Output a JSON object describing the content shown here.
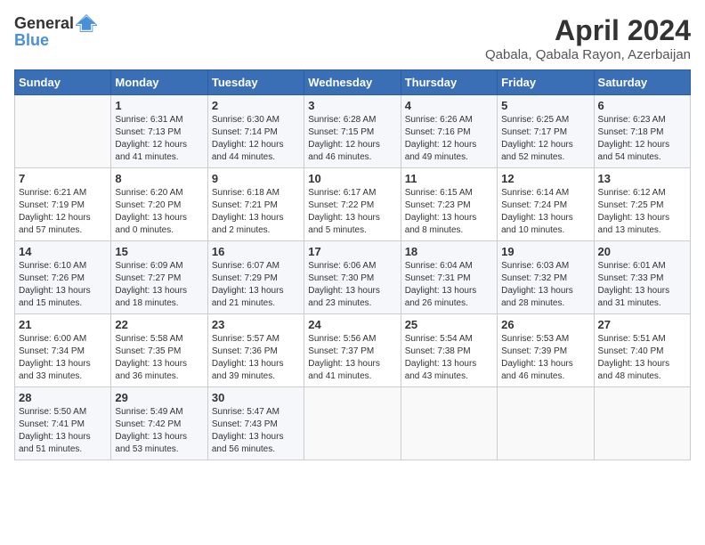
{
  "header": {
    "logo_general": "General",
    "logo_blue": "Blue",
    "month_title": "April 2024",
    "location": "Qabala, Qabala Rayon, Azerbaijan"
  },
  "calendar": {
    "days_of_week": [
      "Sunday",
      "Monday",
      "Tuesday",
      "Wednesday",
      "Thursday",
      "Friday",
      "Saturday"
    ],
    "weeks": [
      [
        {
          "day": "",
          "sunrise": "",
          "sunset": "",
          "daylight": ""
        },
        {
          "day": "1",
          "sunrise": "Sunrise: 6:31 AM",
          "sunset": "Sunset: 7:13 PM",
          "daylight": "Daylight: 12 hours and 41 minutes."
        },
        {
          "day": "2",
          "sunrise": "Sunrise: 6:30 AM",
          "sunset": "Sunset: 7:14 PM",
          "daylight": "Daylight: 12 hours and 44 minutes."
        },
        {
          "day": "3",
          "sunrise": "Sunrise: 6:28 AM",
          "sunset": "Sunset: 7:15 PM",
          "daylight": "Daylight: 12 hours and 46 minutes."
        },
        {
          "day": "4",
          "sunrise": "Sunrise: 6:26 AM",
          "sunset": "Sunset: 7:16 PM",
          "daylight": "Daylight: 12 hours and 49 minutes."
        },
        {
          "day": "5",
          "sunrise": "Sunrise: 6:25 AM",
          "sunset": "Sunset: 7:17 PM",
          "daylight": "Daylight: 12 hours and 52 minutes."
        },
        {
          "day": "6",
          "sunrise": "Sunrise: 6:23 AM",
          "sunset": "Sunset: 7:18 PM",
          "daylight": "Daylight: 12 hours and 54 minutes."
        }
      ],
      [
        {
          "day": "7",
          "sunrise": "Sunrise: 6:21 AM",
          "sunset": "Sunset: 7:19 PM",
          "daylight": "Daylight: 12 hours and 57 minutes."
        },
        {
          "day": "8",
          "sunrise": "Sunrise: 6:20 AM",
          "sunset": "Sunset: 7:20 PM",
          "daylight": "Daylight: 13 hours and 0 minutes."
        },
        {
          "day": "9",
          "sunrise": "Sunrise: 6:18 AM",
          "sunset": "Sunset: 7:21 PM",
          "daylight": "Daylight: 13 hours and 2 minutes."
        },
        {
          "day": "10",
          "sunrise": "Sunrise: 6:17 AM",
          "sunset": "Sunset: 7:22 PM",
          "daylight": "Daylight: 13 hours and 5 minutes."
        },
        {
          "day": "11",
          "sunrise": "Sunrise: 6:15 AM",
          "sunset": "Sunset: 7:23 PM",
          "daylight": "Daylight: 13 hours and 8 minutes."
        },
        {
          "day": "12",
          "sunrise": "Sunrise: 6:14 AM",
          "sunset": "Sunset: 7:24 PM",
          "daylight": "Daylight: 13 hours and 10 minutes."
        },
        {
          "day": "13",
          "sunrise": "Sunrise: 6:12 AM",
          "sunset": "Sunset: 7:25 PM",
          "daylight": "Daylight: 13 hours and 13 minutes."
        }
      ],
      [
        {
          "day": "14",
          "sunrise": "Sunrise: 6:10 AM",
          "sunset": "Sunset: 7:26 PM",
          "daylight": "Daylight: 13 hours and 15 minutes."
        },
        {
          "day": "15",
          "sunrise": "Sunrise: 6:09 AM",
          "sunset": "Sunset: 7:27 PM",
          "daylight": "Daylight: 13 hours and 18 minutes."
        },
        {
          "day": "16",
          "sunrise": "Sunrise: 6:07 AM",
          "sunset": "Sunset: 7:29 PM",
          "daylight": "Daylight: 13 hours and 21 minutes."
        },
        {
          "day": "17",
          "sunrise": "Sunrise: 6:06 AM",
          "sunset": "Sunset: 7:30 PM",
          "daylight": "Daylight: 13 hours and 23 minutes."
        },
        {
          "day": "18",
          "sunrise": "Sunrise: 6:04 AM",
          "sunset": "Sunset: 7:31 PM",
          "daylight": "Daylight: 13 hours and 26 minutes."
        },
        {
          "day": "19",
          "sunrise": "Sunrise: 6:03 AM",
          "sunset": "Sunset: 7:32 PM",
          "daylight": "Daylight: 13 hours and 28 minutes."
        },
        {
          "day": "20",
          "sunrise": "Sunrise: 6:01 AM",
          "sunset": "Sunset: 7:33 PM",
          "daylight": "Daylight: 13 hours and 31 minutes."
        }
      ],
      [
        {
          "day": "21",
          "sunrise": "Sunrise: 6:00 AM",
          "sunset": "Sunset: 7:34 PM",
          "daylight": "Daylight: 13 hours and 33 minutes."
        },
        {
          "day": "22",
          "sunrise": "Sunrise: 5:58 AM",
          "sunset": "Sunset: 7:35 PM",
          "daylight": "Daylight: 13 hours and 36 minutes."
        },
        {
          "day": "23",
          "sunrise": "Sunrise: 5:57 AM",
          "sunset": "Sunset: 7:36 PM",
          "daylight": "Daylight: 13 hours and 39 minutes."
        },
        {
          "day": "24",
          "sunrise": "Sunrise: 5:56 AM",
          "sunset": "Sunset: 7:37 PM",
          "daylight": "Daylight: 13 hours and 41 minutes."
        },
        {
          "day": "25",
          "sunrise": "Sunrise: 5:54 AM",
          "sunset": "Sunset: 7:38 PM",
          "daylight": "Daylight: 13 hours and 43 minutes."
        },
        {
          "day": "26",
          "sunrise": "Sunrise: 5:53 AM",
          "sunset": "Sunset: 7:39 PM",
          "daylight": "Daylight: 13 hours and 46 minutes."
        },
        {
          "day": "27",
          "sunrise": "Sunrise: 5:51 AM",
          "sunset": "Sunset: 7:40 PM",
          "daylight": "Daylight: 13 hours and 48 minutes."
        }
      ],
      [
        {
          "day": "28",
          "sunrise": "Sunrise: 5:50 AM",
          "sunset": "Sunset: 7:41 PM",
          "daylight": "Daylight: 13 hours and 51 minutes."
        },
        {
          "day": "29",
          "sunrise": "Sunrise: 5:49 AM",
          "sunset": "Sunset: 7:42 PM",
          "daylight": "Daylight: 13 hours and 53 minutes."
        },
        {
          "day": "30",
          "sunrise": "Sunrise: 5:47 AM",
          "sunset": "Sunset: 7:43 PM",
          "daylight": "Daylight: 13 hours and 56 minutes."
        },
        {
          "day": "",
          "sunrise": "",
          "sunset": "",
          "daylight": ""
        },
        {
          "day": "",
          "sunrise": "",
          "sunset": "",
          "daylight": ""
        },
        {
          "day": "",
          "sunrise": "",
          "sunset": "",
          "daylight": ""
        },
        {
          "day": "",
          "sunrise": "",
          "sunset": "",
          "daylight": ""
        }
      ]
    ]
  }
}
